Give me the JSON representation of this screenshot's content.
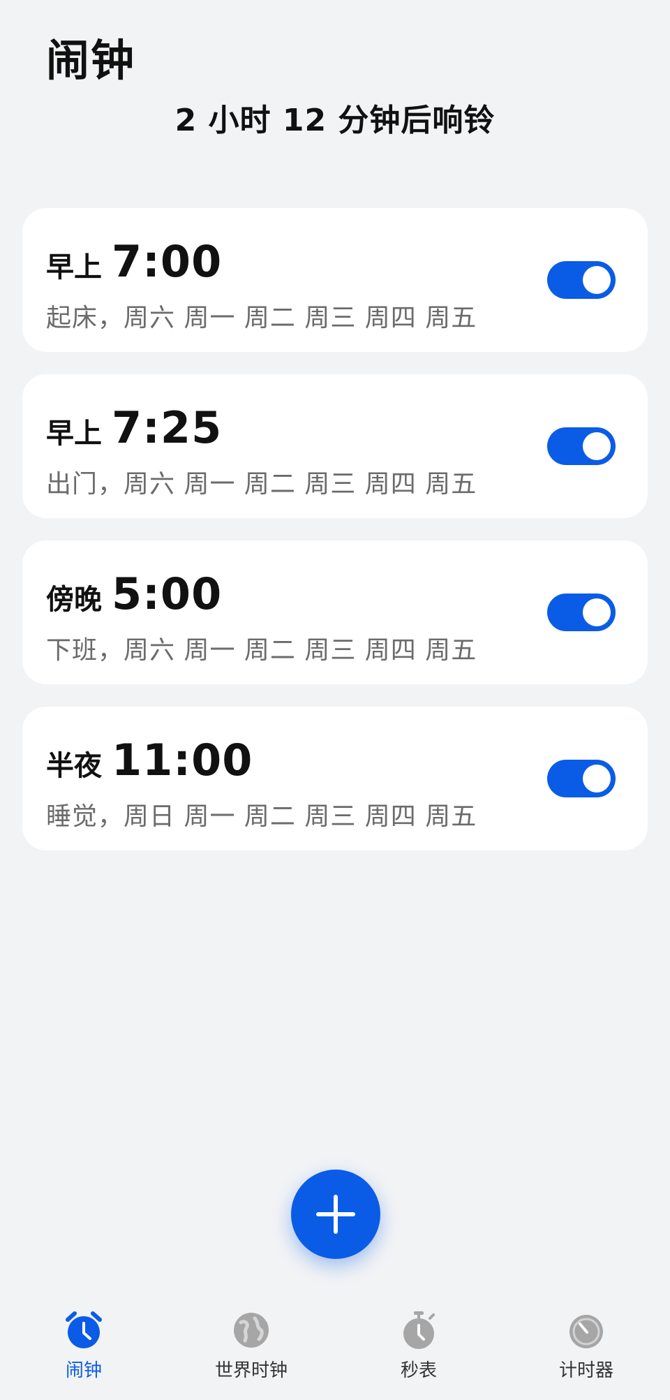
{
  "header": {
    "title": "闹钟",
    "ring_info": "2 小时 12 分钟后响铃"
  },
  "alarms": [
    {
      "period": "早上",
      "time": "7:00",
      "description": "起床，周六 周一 周二 周三 周四 周五",
      "enabled": true
    },
    {
      "period": "早上",
      "time": "7:25",
      "description": "出门，周六 周一 周二 周三 周四 周五",
      "enabled": true
    },
    {
      "period": "傍晚",
      "time": "5:00",
      "description": "下班，周六 周一 周二 周三 周四 周五",
      "enabled": true
    },
    {
      "period": "半夜",
      "time": "11:00",
      "description": "睡觉，周日 周一 周二 周三 周四 周五",
      "enabled": true
    }
  ],
  "fab": {
    "icon": "plus-icon"
  },
  "bottom_nav": {
    "items": [
      {
        "label": "闹钟",
        "icon": "alarm-clock-icon",
        "active": true
      },
      {
        "label": "世界时钟",
        "icon": "globe-icon",
        "active": false
      },
      {
        "label": "秒表",
        "icon": "stopwatch-icon",
        "active": false
      },
      {
        "label": "计时器",
        "icon": "timer-icon",
        "active": false
      }
    ]
  },
  "colors": {
    "accent": "#0a5ce6",
    "background": "#f1f3f5",
    "card": "#ffffff",
    "inactive_icon": "#9a9a9a"
  }
}
